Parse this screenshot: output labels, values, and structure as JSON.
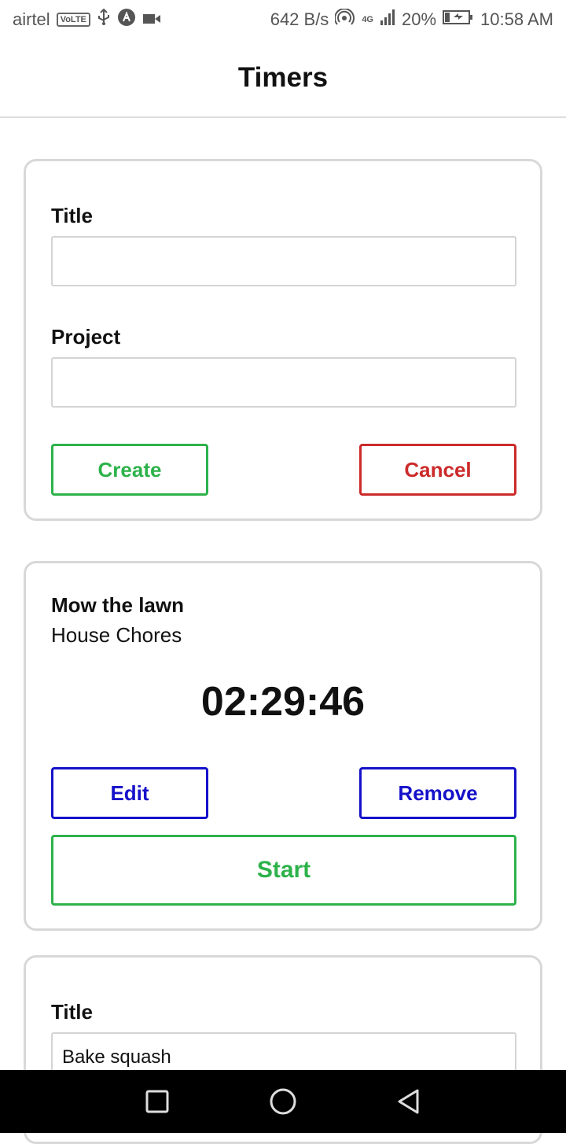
{
  "status_bar": {
    "carrier": "airtel",
    "volte": "VoLTE",
    "net_speed": "642 B/s",
    "network_type": "4G",
    "battery": "20%",
    "time": "10:58 AM"
  },
  "header": {
    "title": "Timers"
  },
  "create_form": {
    "title_label": "Title",
    "title_value": "",
    "project_label": "Project",
    "project_value": "",
    "create_label": "Create",
    "cancel_label": "Cancel"
  },
  "timer": {
    "title": "Mow the lawn",
    "project": "House Chores",
    "elapsed": "02:29:46",
    "edit_label": "Edit",
    "remove_label": "Remove",
    "start_label": "Start"
  },
  "edit_form": {
    "title_label": "Title",
    "title_value": "Bake squash"
  },
  "colors": {
    "green": "#2db24a",
    "red": "#cc2a2a",
    "blue": "#1511c9"
  },
  "icons": [
    "usb-icon",
    "app-icon",
    "video-icon",
    "hotspot-icon",
    "signal-icon",
    "battery-charging-icon",
    "nav-square-icon",
    "nav-home-icon",
    "nav-back-icon"
  ]
}
